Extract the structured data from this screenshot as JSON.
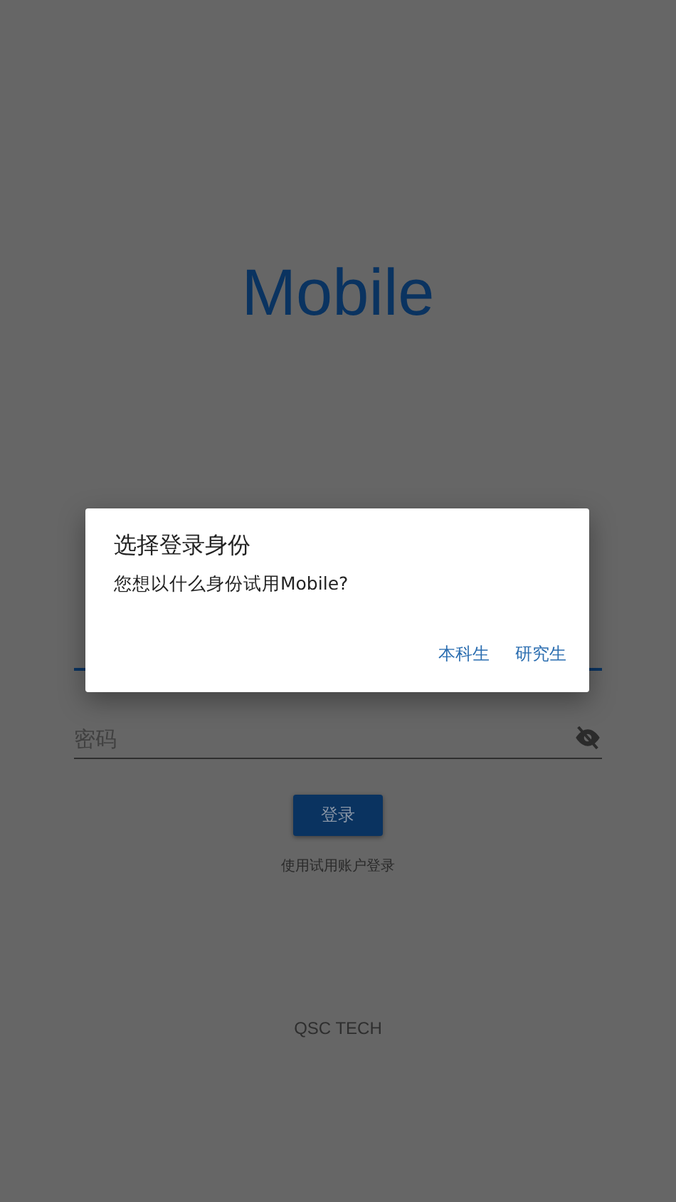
{
  "app_title": "Mobile",
  "form": {
    "username": {
      "focused": true
    },
    "password": {
      "placeholder": "密码",
      "visible": false
    },
    "login_button": "登录",
    "trial_link": "使用试用账户登录"
  },
  "footer": "QSC TECH",
  "dialog": {
    "title": "选择登录身份",
    "message": "您想以什么身份试用Mobile?",
    "actions": [
      "本科生",
      "研究生"
    ]
  }
}
